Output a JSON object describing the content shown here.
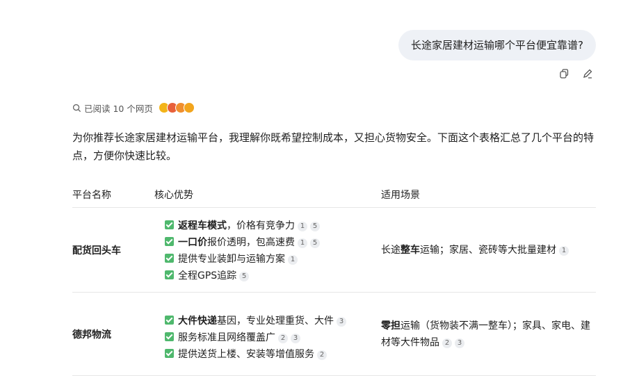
{
  "user_message": "长途家居建材运输哪个平台便宜靠谱?",
  "read_status": "已阅读 10 个网页",
  "intro": "为你推荐长途家居建材运输平台，我理解你既希望控制成本，又担心货物安全。下面这个表格汇总了几个平台的特点，方便你快速比较。",
  "table": {
    "headers": [
      "平台名称",
      "核心优势",
      "适用场景"
    ],
    "rows": [
      {
        "name": "配货回头车",
        "advantages": [
          {
            "bold": "返程车模式",
            "text": "，价格有竞争力",
            "cites": [
              "1",
              "5"
            ]
          },
          {
            "bold": "一口价",
            "text": "报价透明，包高速费",
            "cites": [
              "1",
              "5"
            ]
          },
          {
            "bold": "",
            "text": "提供专业装卸与运输方案",
            "cites": [
              "1"
            ]
          },
          {
            "bold": "",
            "text": "全程GPS追踪",
            "cites": [
              "5"
            ]
          }
        ],
        "scene": {
          "pre": "长途",
          "bold": "整车",
          "post": "运输；家居、瓷砖等大批量建材",
          "cites": [
            "1"
          ]
        }
      },
      {
        "name": "德邦物流",
        "advantages": [
          {
            "bold": "大件快递",
            "text": "基因，专业处理重货、大件",
            "cites": [
              "3"
            ]
          },
          {
            "bold": "",
            "text": "服务标准且网络覆盖广",
            "cites": [
              "2",
              "3"
            ]
          },
          {
            "bold": "",
            "text": "提供送货上楼、安装等增值服务",
            "cites": [
              "2"
            ]
          }
        ],
        "scene": {
          "pre": "",
          "bold": "零担",
          "post": "运输（货物装不满一整车）；家具、家电、建材等大件物品",
          "cites": [
            "2",
            "3"
          ]
        }
      }
    ]
  },
  "icons": {
    "copy": "copy-icon",
    "edit": "edit-icon",
    "search": "search-icon"
  },
  "colors": {
    "bubble": "#eef1f6",
    "check": "#4fb86d",
    "cite_bg": "#ebedf0"
  }
}
